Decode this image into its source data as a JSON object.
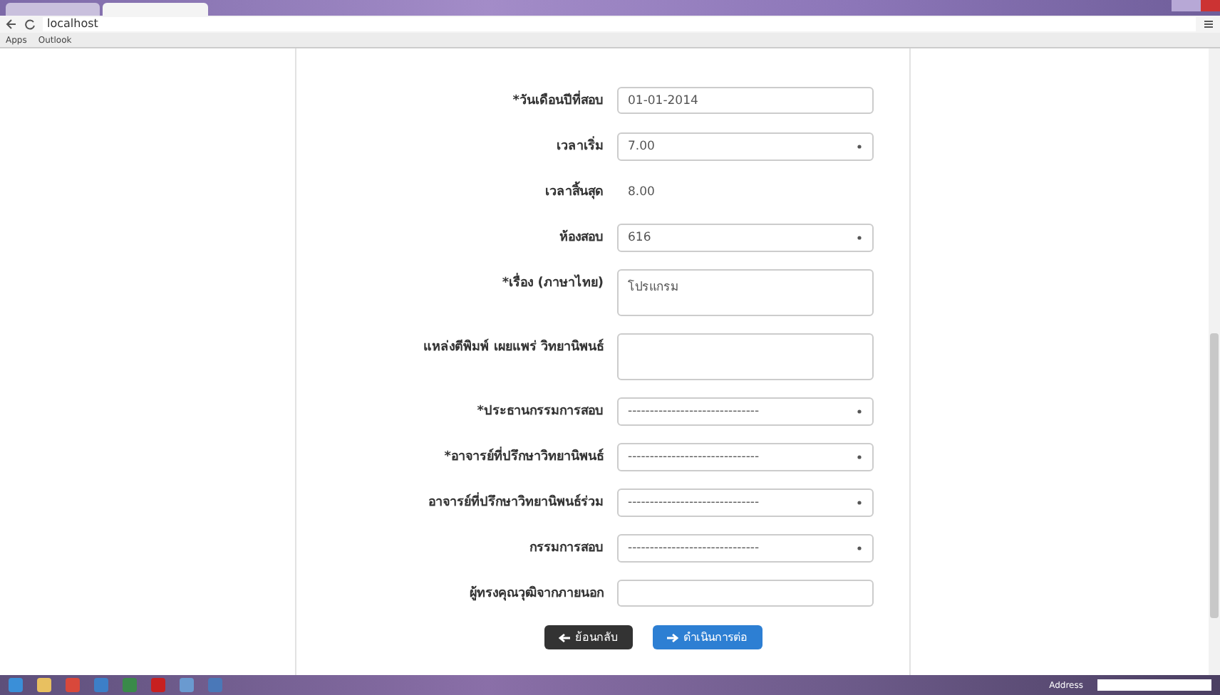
{
  "browser": {
    "address": "localhost",
    "bookmarks": [
      "Apps",
      "Outlook"
    ]
  },
  "form": {
    "fields": [
      {
        "kind": "input",
        "label": "*วันเดือนปีที่สอบ",
        "value": "01-01-2014"
      },
      {
        "kind": "select",
        "label": "เวลาเริ่ม",
        "value": "7.00"
      },
      {
        "kind": "static",
        "label": "เวลาสิ้นสุด",
        "value": "8.00"
      },
      {
        "kind": "select",
        "label": "ห้องสอบ",
        "value": "616"
      },
      {
        "kind": "textarea",
        "label": "*เรื่อง (ภาษาไทย)",
        "value": "โปรแกรม"
      },
      {
        "kind": "textarea",
        "label": "แหล่งตีพิมพ์ เผยแพร่ วิทยานิพนธ์"
      },
      {
        "kind": "select",
        "label": "*ประธานกรรมการสอบ",
        "value": "------------------------------"
      },
      {
        "kind": "select",
        "label": "*อาจารย์ที่ปรึกษาวิทยานิพนธ์",
        "value": "------------------------------"
      },
      {
        "kind": "select",
        "label": "อาจารย์ที่ปรึกษาวิทยานิพนธ์ร่วม",
        "value": "------------------------------"
      },
      {
        "kind": "select",
        "label": "กรรมการสอบ",
        "value": "------------------------------"
      },
      {
        "kind": "input",
        "label": "ผู้ทรงคุณวุฒิจากภายนอก"
      }
    ],
    "buttons": [
      {
        "kind": "back",
        "label": "ย้อนกลับ"
      },
      {
        "kind": "next",
        "label": "ดำเนินการต่อ"
      }
    ]
  },
  "taskbar": {
    "address_label": "Address"
  }
}
